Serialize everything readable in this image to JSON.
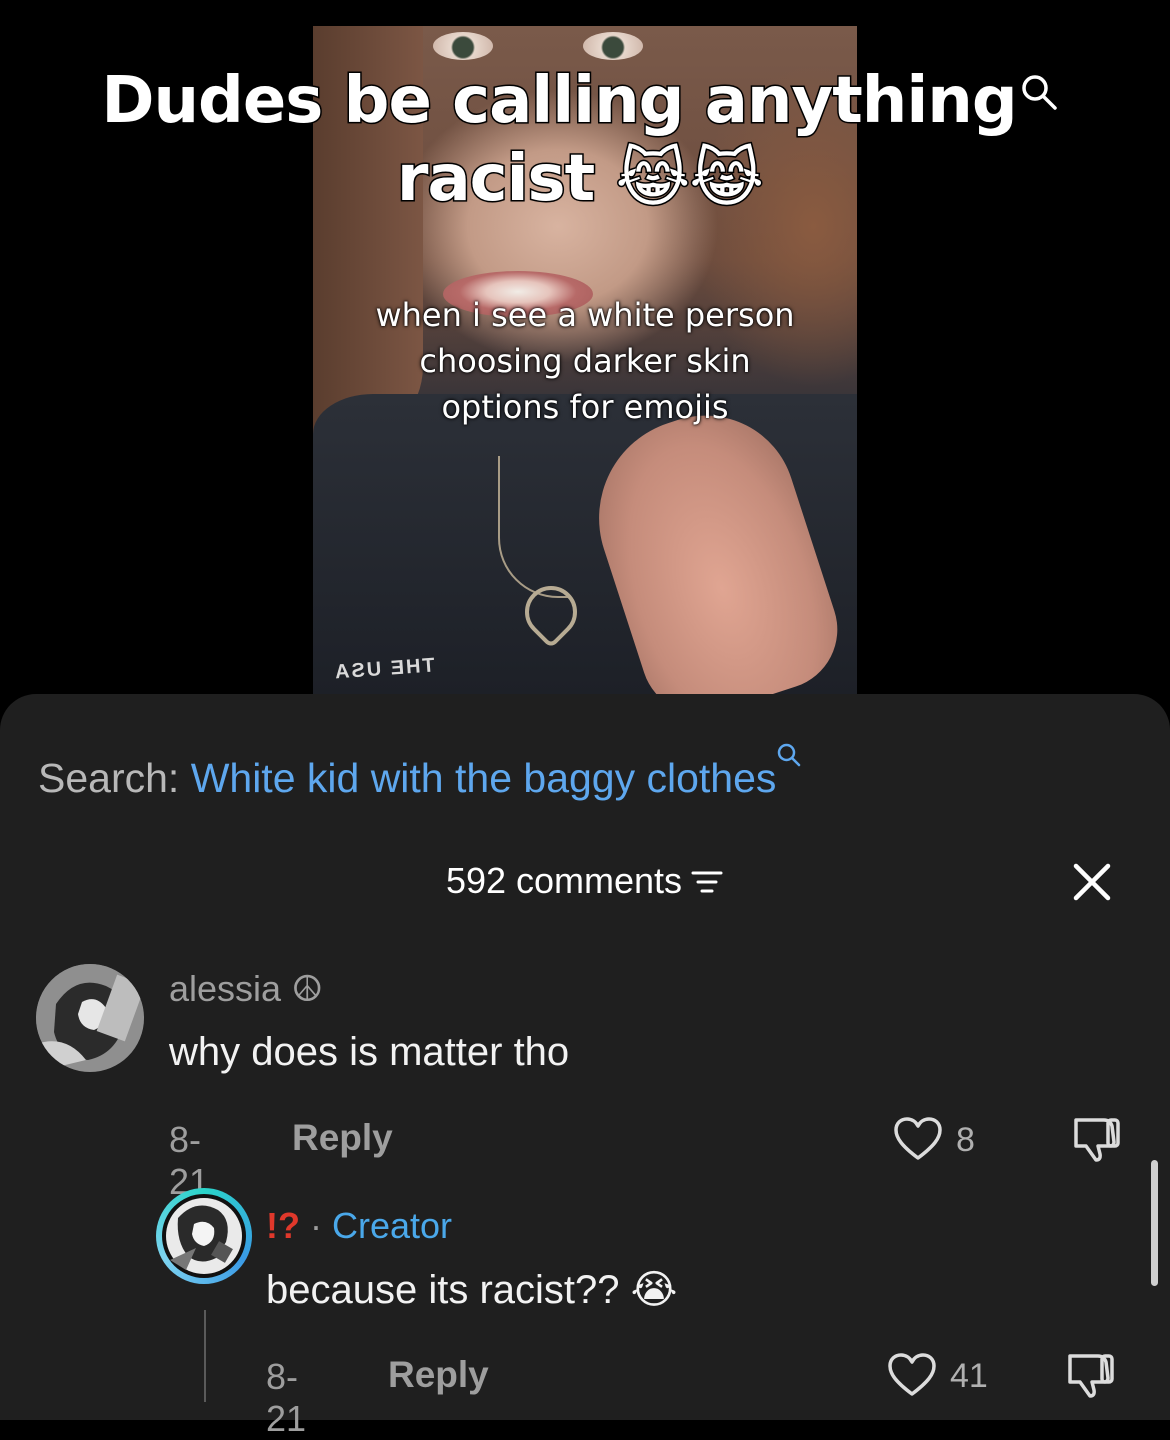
{
  "video": {
    "caption_line1": "Dudes be calling anything",
    "caption_line2": "racist 😹😹",
    "overlay_lines": [
      "when i see a white person",
      "choosing darker skin",
      "options for emojis"
    ],
    "shirt_print": "THE USA"
  },
  "search": {
    "prefix": "Search: ",
    "term": "White kid with the baggy clothes"
  },
  "header": {
    "comments_count_label": "592 comments"
  },
  "comments": [
    {
      "username": "alessia ☮",
      "text": "why does is matter tho",
      "date": "8-21",
      "reply_label": "Reply",
      "likes": "8"
    }
  ],
  "replies": [
    {
      "username_mark": "!?",
      "separator": " · ",
      "badge": "Creator",
      "text": "because its racist?? 😭",
      "date": "8-21",
      "reply_label": "Reply",
      "likes": "41"
    }
  ],
  "icons": {
    "search": "search-icon",
    "sort": "sort-icon",
    "close": "close-icon",
    "like": "heart-outline-icon",
    "dislike": "thumbs-down-icon"
  },
  "colors": {
    "sheet_background": "#1f1f1f",
    "search_term": "#5ea7ee",
    "creator_badge": "#4aa8ea",
    "creator_mark": "#e0382b"
  }
}
